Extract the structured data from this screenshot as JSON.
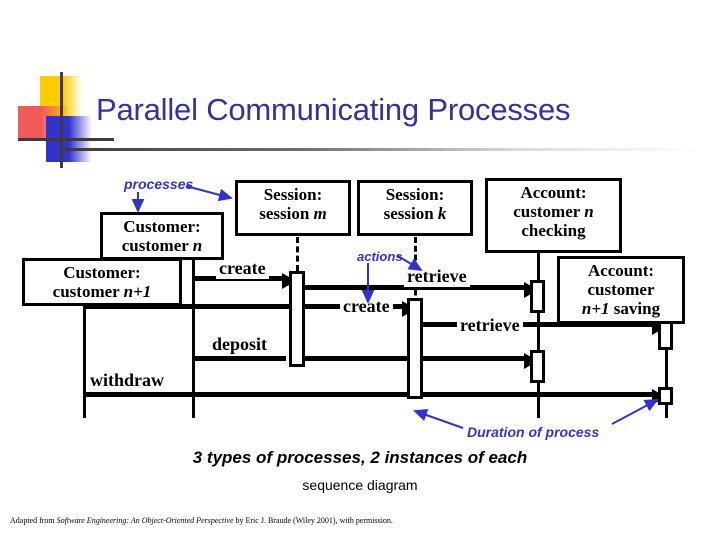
{
  "slide": {
    "title": "Parallel Communicating Processes",
    "caption_main": "3 types of processes, 2 instances of each",
    "caption_sub": "sequence diagram",
    "footer_prefix": "Adapted from ",
    "footer_italic": "Software Engineering: An Object-Oriented Perspective",
    "footer_suffix": " by Eric J. Braude (Wiley 2001), with permission.",
    "accent_title_color": "#333399",
    "annotation_color": "#3333cc",
    "diagram_line_color": "#000000"
  },
  "annotations": [
    {
      "id": "processes",
      "label": "processes"
    },
    {
      "id": "actions",
      "label": "actions"
    },
    {
      "id": "duration",
      "label": "Duration of process"
    }
  ],
  "objects": [
    {
      "id": "customer-n",
      "line1": "Customer:",
      "line2": "customer ",
      "italic2": "n",
      "line3": ""
    },
    {
      "id": "customer-n1",
      "line1": "Customer:",
      "line2": "customer ",
      "italic2": "n+1",
      "line3": ""
    },
    {
      "id": "session-m",
      "line1": "Session:",
      "line2": "session ",
      "italic2": "m",
      "line3": ""
    },
    {
      "id": "session-k",
      "line1": "Session:",
      "line2": "session ",
      "italic2": "k",
      "line3": ""
    },
    {
      "id": "account-n-checking",
      "line1": "Account:",
      "line2": "customer ",
      "italic2": "n",
      "line3": "checking"
    },
    {
      "id": "account-n1-saving",
      "line1": "Account:",
      "line2": "customer",
      "italic2": "n+1",
      "line3": " saving"
    }
  ],
  "messages": [
    {
      "id": "create-1",
      "label": "create"
    },
    {
      "id": "create-2",
      "label": "create"
    },
    {
      "id": "retrieve-1",
      "label": "retrieve"
    },
    {
      "id": "retrieve-2",
      "label": "retrieve"
    },
    {
      "id": "deposit",
      "label": "deposit"
    },
    {
      "id": "withdraw",
      "label": "withdraw"
    }
  ]
}
